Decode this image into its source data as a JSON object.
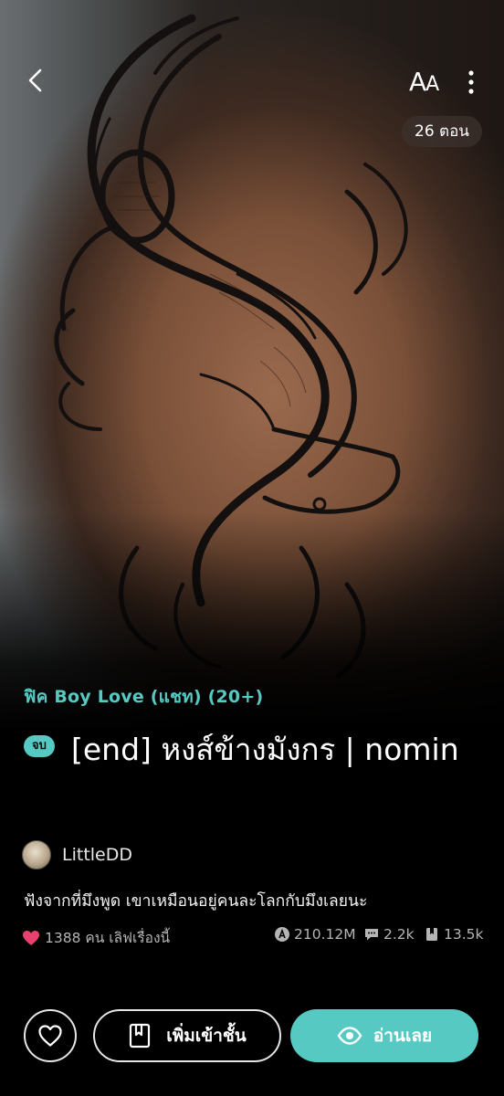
{
  "header": {
    "font_size_label_big": "A",
    "font_size_label_small": "A",
    "episodes_badge": "26 ตอน"
  },
  "story": {
    "genre": "ฟิค Boy Love (แชท) (20+)",
    "status": "จบ",
    "title": "[end] หงส์ข้างมังกร | nomin",
    "author": "LittleDD",
    "synopsis": "ฟังจากที่มึงพูด เขาเหมือนอยู่คนละโลกกับมึงเลยนะ"
  },
  "stats": {
    "likes": "1388 คน เลิฟเรื่องนี้",
    "views": "210.12M",
    "comments": "2.2k",
    "chapters_read": "13.5k"
  },
  "actions": {
    "add_library_label": "เพิ่มเข้าชั้น",
    "read_label": "อ่านเลย"
  },
  "colors": {
    "accent": "#57c9c3",
    "like_heart": "#e8416f",
    "background": "#000000"
  },
  "icons": {
    "back": "chevron-left-icon",
    "font_size": "font-size-icon",
    "more": "more-vertical-icon",
    "heart": "heart-icon",
    "views": "views-icon",
    "comments": "comment-icon",
    "chapters": "book-icon",
    "bookmark": "bookmark-book-icon",
    "eye": "eye-icon"
  }
}
